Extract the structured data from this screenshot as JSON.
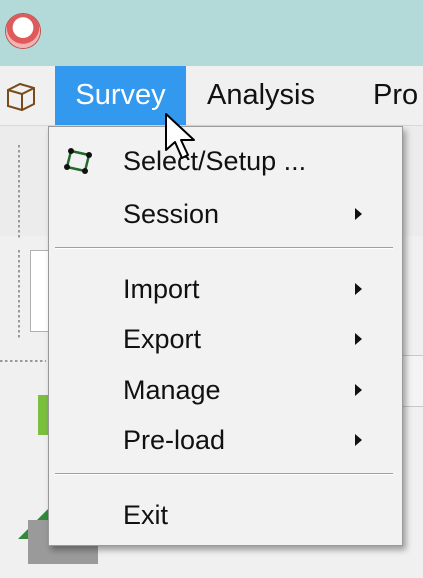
{
  "menubar": {
    "items": [
      {
        "label": "Survey",
        "active": true
      },
      {
        "label": "Analysis"
      },
      {
        "label": "Pro"
      }
    ]
  },
  "dropdown": {
    "items": [
      {
        "label": "Select/Setup ...",
        "icon": "polygon-select-icon",
        "submenu": false
      },
      {
        "label": "Session",
        "submenu": true
      },
      {
        "separator": true
      },
      {
        "label": "Import",
        "submenu": true
      },
      {
        "label": "Export",
        "submenu": true
      },
      {
        "label": "Manage",
        "submenu": true
      },
      {
        "label": "Pre-load",
        "submenu": true
      },
      {
        "separator": true
      },
      {
        "label": "Exit",
        "submenu": false
      }
    ]
  },
  "colors": {
    "titlebar": "#b4d9d9",
    "menu_highlight": "#3399ee",
    "menu_background": "#f2f2f2",
    "select_icon": "#2e7d32"
  }
}
